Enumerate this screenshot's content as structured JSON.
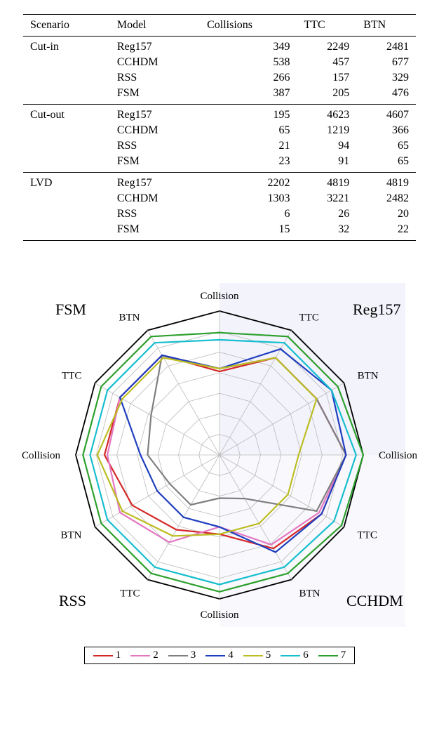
{
  "table": {
    "headers": [
      "Scenario",
      "Model",
      "Collisions",
      "TTC",
      "BTN"
    ],
    "groups": [
      {
        "scenario": "Cut-in",
        "rows": [
          {
            "model": "Reg157",
            "collisions": 349,
            "ttc": 2249,
            "btn": 2481
          },
          {
            "model": "CCHDM",
            "collisions": 538,
            "ttc": 457,
            "btn": 677
          },
          {
            "model": "RSS",
            "collisions": 266,
            "ttc": 157,
            "btn": 329
          },
          {
            "model": "FSM",
            "collisions": 387,
            "ttc": 205,
            "btn": 476
          }
        ]
      },
      {
        "scenario": "Cut-out",
        "rows": [
          {
            "model": "Reg157",
            "collisions": 195,
            "ttc": 4623,
            "btn": 4607
          },
          {
            "model": "CCHDM",
            "collisions": 65,
            "ttc": 1219,
            "btn": 366
          },
          {
            "model": "RSS",
            "collisions": 21,
            "ttc": 94,
            "btn": 65
          },
          {
            "model": "FSM",
            "collisions": 23,
            "ttc": 91,
            "btn": 65
          }
        ]
      },
      {
        "scenario": "LVD",
        "rows": [
          {
            "model": "Reg157",
            "collisions": 2202,
            "ttc": 4819,
            "btn": 4819
          },
          {
            "model": "CCHDM",
            "collisions": 1303,
            "ttc": 3221,
            "btn": 2482
          },
          {
            "model": "RSS",
            "collisions": 6,
            "ttc": 26,
            "btn": 20
          },
          {
            "model": "FSM",
            "collisions": 15,
            "ttc": 32,
            "btn": 22
          }
        ]
      }
    ]
  },
  "chart_data": {
    "type": "radar",
    "axes": [
      "Collision",
      "TTC",
      "BTN",
      "Collision",
      "TTC",
      "BTN",
      "Collision",
      "TTC",
      "BTN",
      "Collision",
      "TTC",
      "BTN"
    ],
    "quadrant_labels": [
      "Reg157",
      "CCHDM",
      "RSS",
      "FSM"
    ],
    "radial_levels": 7,
    "series": [
      {
        "name": "1",
        "color": "#D62728",
        "values": [
          0.58,
          0.78,
          0.78,
          0.88,
          0.82,
          0.75,
          0.55,
          0.6,
          0.7,
          0.8,
          0.8,
          0.8
        ]
      },
      {
        "name": "2",
        "color": "#E377C2",
        "values": [
          0.6,
          0.78,
          0.78,
          0.88,
          0.8,
          0.72,
          0.5,
          0.7,
          0.8,
          0.78,
          0.8,
          0.8
        ]
      },
      {
        "name": "3",
        "color": "#7F7F7F",
        "values": [
          0.6,
          0.78,
          0.78,
          0.88,
          0.78,
          0.35,
          0.3,
          0.4,
          0.4,
          0.5,
          0.55,
          0.8
        ]
      },
      {
        "name": "4",
        "color": "#1F3FBF",
        "values": [
          0.6,
          0.85,
          0.9,
          0.88,
          0.82,
          0.78,
          0.5,
          0.5,
          0.5,
          0.55,
          0.8,
          0.8
        ]
      },
      {
        "name": "5",
        "color": "#BCBD22",
        "values": [
          0.6,
          0.78,
          0.78,
          0.55,
          0.55,
          0.55,
          0.55,
          0.65,
          0.78,
          0.85,
          0.78,
          0.78
        ]
      },
      {
        "name": "6",
        "color": "#17BECF",
        "values": [
          0.8,
          0.9,
          0.9,
          0.95,
          0.92,
          0.9,
          0.9,
          0.9,
          0.9,
          0.9,
          0.9,
          0.9
        ]
      },
      {
        "name": "7",
        "color": "#2CA02C",
        "values": [
          0.85,
          0.95,
          0.95,
          1.0,
          0.98,
          0.95,
          0.95,
          0.95,
          0.95,
          0.95,
          0.95,
          0.95
        ]
      }
    ],
    "legend_labels": [
      "1",
      "2",
      "3",
      "4",
      "5",
      "6",
      "7"
    ]
  }
}
